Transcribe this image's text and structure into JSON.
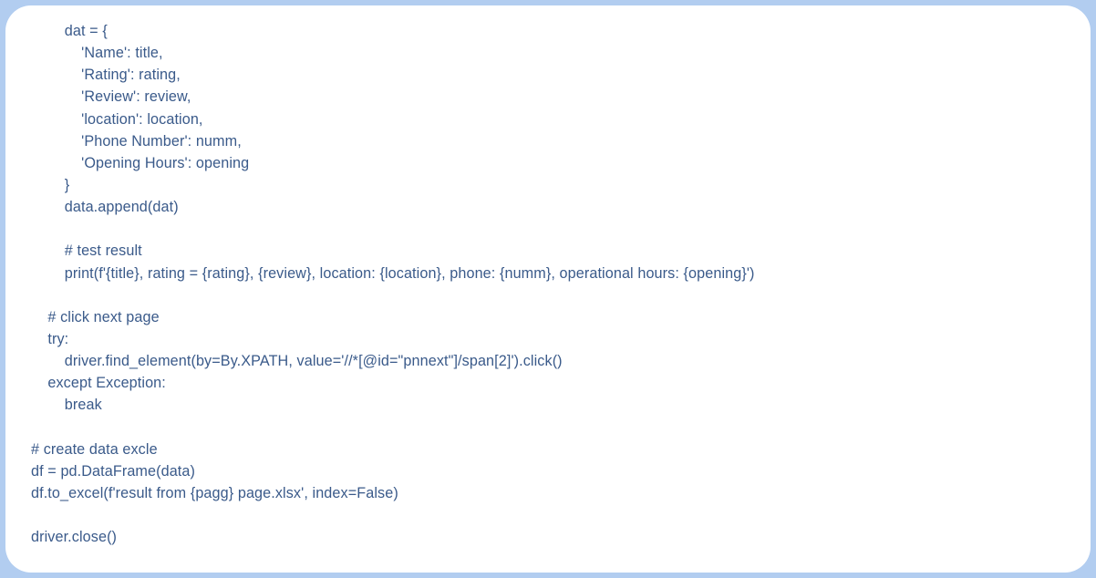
{
  "code": "        dat = {\n            'Name': title,\n            'Rating': rating,\n            'Review': review,\n            'location': location,\n            'Phone Number': numm,\n            'Opening Hours': opening\n        }\n        data.append(dat)\n\n        # test result\n        print(f'{title}, rating = {rating}, {review}, location: {location}, phone: {numm}, operational hours: {opening}')\n\n    # click next page\n    try:\n        driver.find_element(by=By.XPATH, value='//*[@id=\"pnnext\"]/span[2]').click()\n    except Exception:\n        break\n\n# create data excle\ndf = pd.DataFrame(data)\ndf.to_excel(f'result from {pagg} page.xlsx', index=False)\n\ndriver.close()"
}
